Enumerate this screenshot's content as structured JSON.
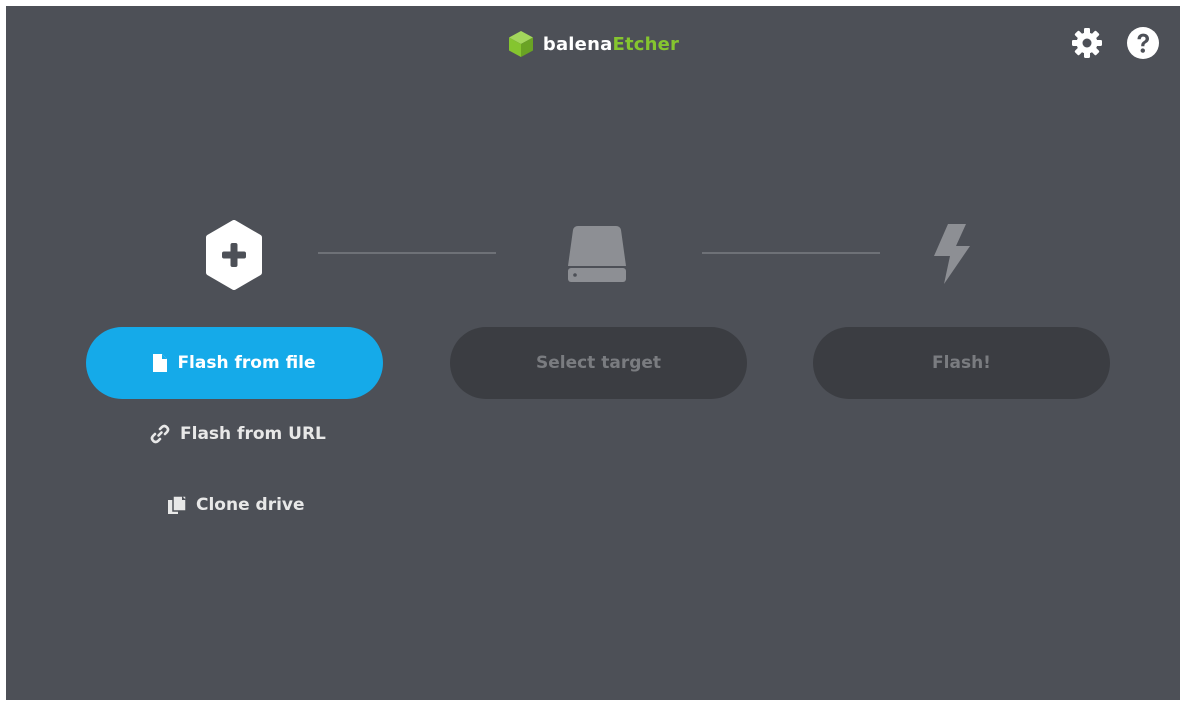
{
  "header": {
    "brand_part1": "balena",
    "brand_part2": "Etcher",
    "settings_icon": "gear-icon",
    "help_icon": "question-circle-icon"
  },
  "steps": [
    {
      "icon": "plus-hexagon-icon",
      "button_label": "Flash from file",
      "button_icon": "file-icon",
      "state": "active"
    },
    {
      "icon": "drive-icon",
      "button_label": "Select target",
      "state": "disabled"
    },
    {
      "icon": "lightning-bolt-icon",
      "button_label": "Flash!",
      "state": "disabled"
    }
  ],
  "alt_actions": [
    {
      "label": "Flash from URL",
      "icon": "link-icon"
    },
    {
      "label": "Clone drive",
      "icon": "copy-icon"
    }
  ],
  "colors": {
    "background": "#4d5057",
    "accent": "#15aae9",
    "brand_green": "#85c52f",
    "disabled_button": "#3b3d42",
    "disabled_text": "#7a7c80"
  }
}
